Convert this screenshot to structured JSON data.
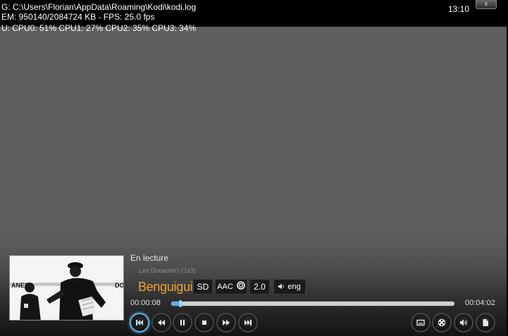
{
  "debug": {
    "line1": "G: C:\\Users\\Florian\\AppData\\Roaming\\Kodi\\kodi.log",
    "line2": "EM: 950140/2084724 KB - FPS: 25.0 fps",
    "line3": "U: CPU0:  51% CPU1:  27% CPU2:  35% CPU3:  34%"
  },
  "clock": "13:10",
  "close_label": "x",
  "thumbnail": {
    "left_text": "ANES",
    "right_text": "DO"
  },
  "player": {
    "status": "En lecture",
    "episode": "Les Douaniers (1x3)",
    "title": "Benguigui",
    "badges": {
      "video": "SD",
      "audio_codec": "AAC",
      "channels": "2.0",
      "language": "eng"
    },
    "elapsed": "00:00:08",
    "total": "00:04:02",
    "progress_fraction": 0.033
  },
  "controls": [
    {
      "name": "previous-button",
      "icon": "skip-previous-icon"
    },
    {
      "name": "rewind-button",
      "icon": "rewind-icon"
    },
    {
      "name": "pause-button",
      "icon": "pause-icon"
    },
    {
      "name": "stop-button",
      "icon": "stop-icon"
    },
    {
      "name": "fast-forward-button",
      "icon": "fast-forward-icon"
    },
    {
      "name": "next-button",
      "icon": "skip-next-icon"
    },
    {
      "name": "subtitles-button",
      "icon": "subtitles-icon"
    },
    {
      "name": "video-settings-button",
      "icon": "film-reel-icon"
    },
    {
      "name": "audio-settings-button",
      "icon": "volume-icon"
    },
    {
      "name": "info-button",
      "icon": "document-icon"
    }
  ],
  "colors": {
    "accent": "#5ab4e6",
    "title": "#f0a030"
  }
}
